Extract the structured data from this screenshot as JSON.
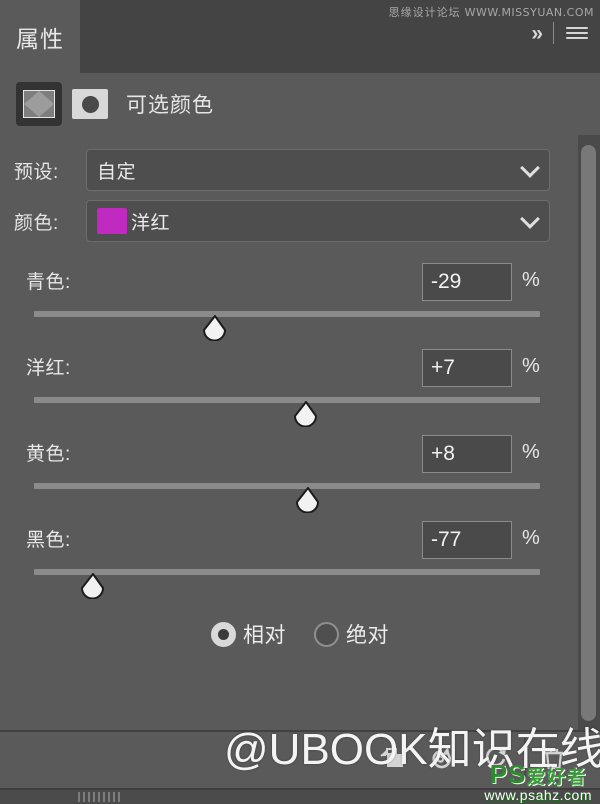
{
  "panel": {
    "tab_label": "属性",
    "expand_icon": "chevron-double-right-icon",
    "menu_icon": "hamburger-menu-icon",
    "watermark_top_cn": "思缘设计论坛",
    "watermark_top_url": "WWW.MISSYUAN.COM"
  },
  "adjustment": {
    "title": "可选颜色",
    "layer_thumb_icon": "adjustment-layer-thumbnail",
    "mask_thumb_icon": "layer-mask-thumbnail"
  },
  "preset": {
    "label": "预设:",
    "value": "自定",
    "chevron_icon": "chevron-down-icon"
  },
  "color": {
    "label": "颜色:",
    "value": "洋红",
    "swatch_hex": "#c12ac1",
    "chevron_icon": "chevron-down-icon"
  },
  "sliders": [
    {
      "label": "青色:",
      "value": "-29",
      "unit": "%",
      "percent": -29
    },
    {
      "label": "洋红:",
      "value": "+7",
      "unit": "%",
      "percent": 7
    },
    {
      "label": "黄色:",
      "value": "+8",
      "unit": "%",
      "percent": 8
    },
    {
      "label": "黑色:",
      "value": "-77",
      "unit": "%",
      "percent": -77
    }
  ],
  "method": {
    "relative_label": "相对",
    "absolute_label": "绝对",
    "selected": "相对"
  },
  "toolbar": {
    "clip_icon": "clip-to-layer-icon",
    "preview_icon": "toggle-layer-visibility-icon",
    "reset_icon": "reset-adjustment-icon",
    "delete_icon": "delete-layer-icon"
  },
  "watermarks": {
    "ubook": "@UBOOK知识在线",
    "psahz_brand": "PS",
    "psahz_cn": "爱好者",
    "psahz_url": "www.psahz.com"
  },
  "colors": {
    "panel_bg": "#5a5a5a",
    "tabbar_bg": "#444444",
    "field_bg": "#4e4e4e",
    "track": "#8b8b8b",
    "accent_magenta": "#c12ac1"
  }
}
